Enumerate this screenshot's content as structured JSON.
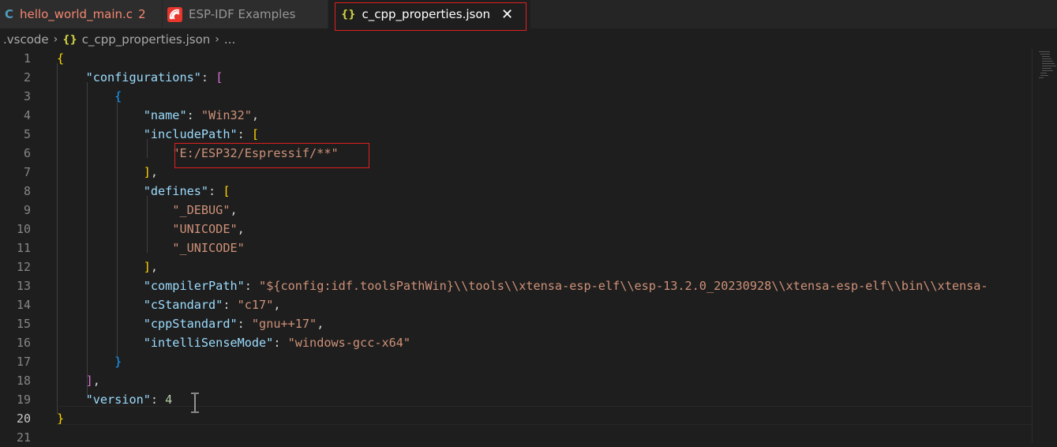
{
  "tabs": [
    {
      "label": "hello_world_main.c",
      "badge": "2",
      "icon": "c-file-icon"
    },
    {
      "label": "ESP-IDF Examples",
      "icon": "espressif-icon"
    },
    {
      "label": "c_cpp_properties.json",
      "icon": "json-file-icon",
      "active": true
    }
  ],
  "breadcrumb": {
    "folder": ".vscode",
    "file": "c_cpp_properties.json",
    "more": "..."
  },
  "lines": [
    {
      "num": "1",
      "tokens": [
        [
          "b1",
          "{"
        ]
      ]
    },
    {
      "num": "2",
      "tokens": [
        [
          "p",
          "    "
        ],
        [
          "k",
          "\"configurations\""
        ],
        [
          "p",
          ": "
        ],
        [
          "b2",
          "["
        ]
      ]
    },
    {
      "num": "3",
      "tokens": [
        [
          "p",
          "        "
        ],
        [
          "b3",
          "{"
        ]
      ]
    },
    {
      "num": "4",
      "tokens": [
        [
          "p",
          "            "
        ],
        [
          "k",
          "\"name\""
        ],
        [
          "p",
          ": "
        ],
        [
          "s",
          "\"Win32\""
        ],
        [
          "p",
          ","
        ]
      ]
    },
    {
      "num": "5",
      "tokens": [
        [
          "p",
          "            "
        ],
        [
          "k",
          "\"includePath\""
        ],
        [
          "p",
          ": "
        ],
        [
          "b1",
          "["
        ]
      ]
    },
    {
      "num": "6",
      "tokens": [
        [
          "p",
          "                "
        ],
        [
          "s",
          "\"E:/ESP32/Espressif/**\""
        ]
      ]
    },
    {
      "num": "7",
      "tokens": [
        [
          "p",
          "            "
        ],
        [
          "b1",
          "]"
        ],
        [
          "p",
          ","
        ]
      ]
    },
    {
      "num": "8",
      "tokens": [
        [
          "p",
          "            "
        ],
        [
          "k",
          "\"defines\""
        ],
        [
          "p",
          ": "
        ],
        [
          "b1",
          "["
        ]
      ]
    },
    {
      "num": "9",
      "tokens": [
        [
          "p",
          "                "
        ],
        [
          "s",
          "\"_DEBUG\""
        ],
        [
          "p",
          ","
        ]
      ]
    },
    {
      "num": "10",
      "tokens": [
        [
          "p",
          "                "
        ],
        [
          "s",
          "\"UNICODE\""
        ],
        [
          "p",
          ","
        ]
      ]
    },
    {
      "num": "11",
      "tokens": [
        [
          "p",
          "                "
        ],
        [
          "s",
          "\"_UNICODE\""
        ]
      ]
    },
    {
      "num": "12",
      "tokens": [
        [
          "p",
          "            "
        ],
        [
          "b1",
          "]"
        ],
        [
          "p",
          ","
        ]
      ]
    },
    {
      "num": "13",
      "tokens": [
        [
          "p",
          "            "
        ],
        [
          "k",
          "\"compilerPath\""
        ],
        [
          "p",
          ": "
        ],
        [
          "s",
          "\"${config:idf.toolsPathWin}\\\\tools\\\\xtensa-esp-elf\\\\esp-13.2.0_20230928\\\\xtensa-esp-elf\\\\bin\\\\xtensa-"
        ]
      ]
    },
    {
      "num": "14",
      "tokens": [
        [
          "p",
          "            "
        ],
        [
          "k",
          "\"cStandard\""
        ],
        [
          "p",
          ": "
        ],
        [
          "s",
          "\"c17\""
        ],
        [
          "p",
          ","
        ]
      ]
    },
    {
      "num": "15",
      "tokens": [
        [
          "p",
          "            "
        ],
        [
          "k",
          "\"cppStandard\""
        ],
        [
          "p",
          ": "
        ],
        [
          "s",
          "\"gnu++17\""
        ],
        [
          "p",
          ","
        ]
      ]
    },
    {
      "num": "16",
      "tokens": [
        [
          "p",
          "            "
        ],
        [
          "k",
          "\"intelliSenseMode\""
        ],
        [
          "p",
          ": "
        ],
        [
          "s",
          "\"windows-gcc-x64\""
        ]
      ]
    },
    {
      "num": "17",
      "tokens": [
        [
          "p",
          "        "
        ],
        [
          "b3",
          "}"
        ]
      ]
    },
    {
      "num": "18",
      "tokens": [
        [
          "p",
          "    "
        ],
        [
          "b2",
          "]"
        ],
        [
          "p",
          ","
        ]
      ]
    },
    {
      "num": "19",
      "tokens": [
        [
          "p",
          "    "
        ],
        [
          "k",
          "\"version\""
        ],
        [
          "p",
          ": "
        ],
        [
          "n",
          "4"
        ]
      ]
    },
    {
      "num": "20",
      "tokens": [
        [
          "b1",
          "}"
        ]
      ],
      "current": true
    },
    {
      "num": "21",
      "tokens": []
    }
  ]
}
